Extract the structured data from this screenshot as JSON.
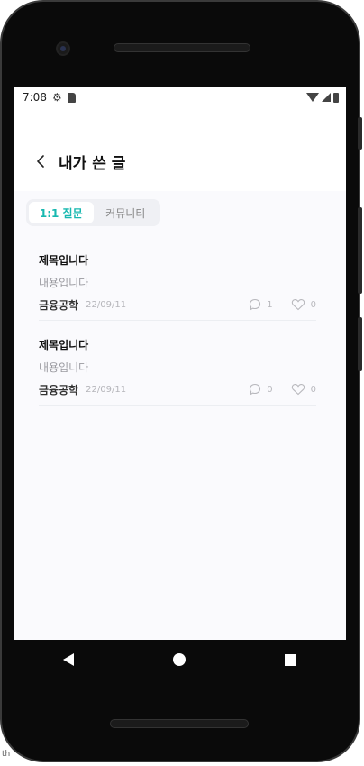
{
  "status_bar": {
    "time": "7:08",
    "icons": [
      "gear-icon",
      "sdcard-icon",
      "wifi-icon",
      "signal-icon",
      "battery-icon"
    ]
  },
  "header": {
    "title": "내가 쓴 글",
    "back_icon": "chevron-left-icon"
  },
  "tabs": [
    {
      "label": "1:1 질문",
      "active": true
    },
    {
      "label": "커뮤니티",
      "active": false
    }
  ],
  "posts": [
    {
      "title": "제목입니다",
      "content": "내용입니다",
      "author": "금융공학",
      "date": "22/09/11",
      "comments": "1",
      "likes": "0"
    },
    {
      "title": "제목입니다",
      "content": "내용입니다",
      "author": "금융공학",
      "date": "22/09/11",
      "comments": "0",
      "likes": "0"
    }
  ],
  "colors": {
    "accent": "#18b8b0",
    "content_bg": "#fafafd",
    "tab_bg": "#eff0f4"
  },
  "footer_text": "th"
}
